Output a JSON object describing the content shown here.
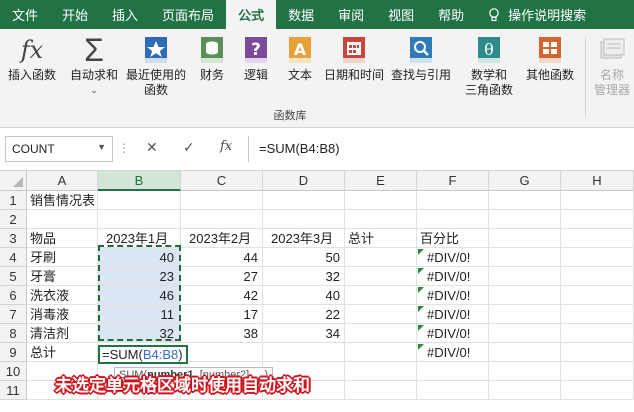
{
  "menu": {
    "tabs": [
      "文件",
      "开始",
      "插入",
      "页面布局",
      "公式",
      "数据",
      "审阅",
      "视图",
      "帮助"
    ],
    "active_index": 4,
    "tell_me": "操作说明搜索"
  },
  "ribbon": {
    "buttons": [
      {
        "label1": "插入函数",
        "label2": "",
        "icon": "fx-icon"
      },
      {
        "label1": "自动求和",
        "label2": "",
        "icon": "sigma-icon"
      },
      {
        "label1": "最近使用的",
        "label2": "函数",
        "icon": "star-book-icon"
      },
      {
        "label1": "财务",
        "label2": "",
        "icon": "coins-book-icon"
      },
      {
        "label1": "逻辑",
        "label2": "",
        "icon": "question-book-icon"
      },
      {
        "label1": "文本",
        "label2": "",
        "icon": "text-book-icon"
      },
      {
        "label1": "日期和时间",
        "label2": "",
        "icon": "calendar-book-icon"
      },
      {
        "label1": "查找与引用",
        "label2": "",
        "icon": "search-book-icon"
      },
      {
        "label1": "数学和",
        "label2": "三角函数",
        "icon": "theta-book-icon"
      },
      {
        "label1": "其他函数",
        "label2": "",
        "icon": "more-book-icon"
      },
      {
        "label1": "名称",
        "label2": "管理器",
        "icon": "name-manager-icon"
      }
    ],
    "group_label": "函数库"
  },
  "formula_bar": {
    "name_box": "COUNT",
    "cancel": "✕",
    "enter": "✓",
    "fx": "fx",
    "formula": "=SUM(B4:B8)"
  },
  "grid": {
    "columns": [
      "A",
      "B",
      "C",
      "D",
      "E",
      "F",
      "G",
      "H"
    ],
    "rows": [
      "1",
      "2",
      "3",
      "4",
      "5",
      "6",
      "7",
      "8",
      "9",
      "10",
      "11"
    ],
    "a1": "销售情况表",
    "headers": [
      "物品",
      "2023年1月",
      "2023年2月",
      "2023年3月",
      "总计",
      "百分比"
    ],
    "items": [
      {
        "name": "牙刷",
        "m1": "40",
        "m2": "44",
        "m3": "50",
        "pct": "#DIV/0!"
      },
      {
        "name": "牙膏",
        "m1": "23",
        "m2": "27",
        "m3": "32",
        "pct": "#DIV/0!"
      },
      {
        "name": "洗衣液",
        "m1": "46",
        "m2": "42",
        "m3": "40",
        "pct": "#DIV/0!"
      },
      {
        "name": "消毒液",
        "m1": "11",
        "m2": "17",
        "m3": "22",
        "pct": "#DIV/0!"
      },
      {
        "name": "清洁剂",
        "m1": "32",
        "m2": "38",
        "m3": "34",
        "pct": "#DIV/0!"
      }
    ],
    "total_label": "总计",
    "total_pct": "#DIV/0!",
    "edit_prefix": "=SUM(",
    "edit_ref": "B4:B8",
    "edit_suffix": ")",
    "tooltip_fn": "SUM(",
    "tooltip_arg1": "number1",
    "tooltip_rest": ", [number2], ...)"
  },
  "caption": "未选定单元格区域时使用自动求和",
  "colors": {
    "excel_green": "#217346",
    "caption_red": "#d0141c",
    "selection_fill": "#dce6f2"
  }
}
